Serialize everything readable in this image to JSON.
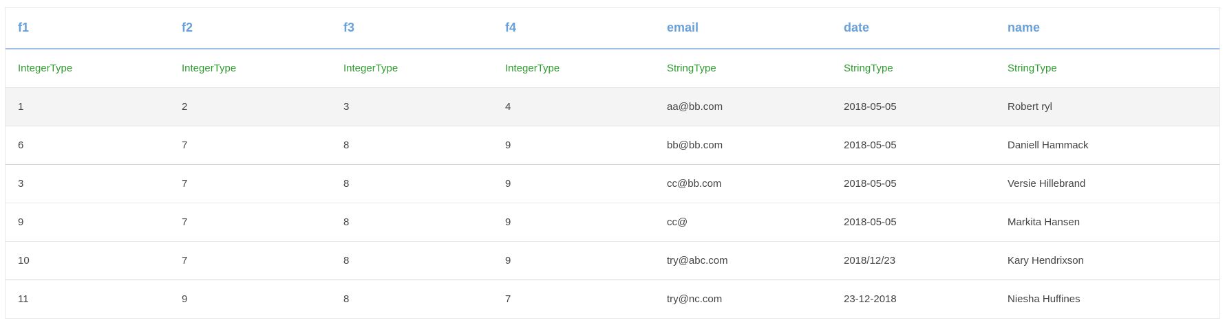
{
  "table": {
    "columns": [
      "f1",
      "f2",
      "f3",
      "f4",
      "email",
      "date",
      "name"
    ],
    "types": [
      "IntegerType",
      "IntegerType",
      "IntegerType",
      "IntegerType",
      "StringType",
      "StringType",
      "StringType"
    ],
    "rows": [
      [
        "1",
        "2",
        "3",
        "4",
        "aa@bb.com",
        "2018-05-05",
        "Robert ryl"
      ],
      [
        "6",
        "7",
        "8",
        "9",
        "bb@bb.com",
        "2018-05-05",
        "Daniell Hammack"
      ],
      [
        "3",
        "7",
        "8",
        "9",
        "cc@bb.com",
        "2018-05-05",
        "Versie Hillebrand"
      ],
      [
        "9",
        "7",
        "8",
        "9",
        "cc@",
        "2018-05-05",
        "Markita Hansen"
      ],
      [
        "10",
        "7",
        "8",
        "9",
        "try@abc.com",
        "2018/12/23",
        "Kary Hendrixson"
      ],
      [
        "11",
        "9",
        "8",
        "7",
        "try@nc.com",
        "23-12-2018",
        "Niesha Huffines"
      ]
    ]
  },
  "colors": {
    "header_text": "#6aa0d8",
    "header_border": "#9ec0e8",
    "type_text": "#2e9b2e",
    "cell_text": "#444444",
    "shaded_row": "#f4f4f4"
  }
}
